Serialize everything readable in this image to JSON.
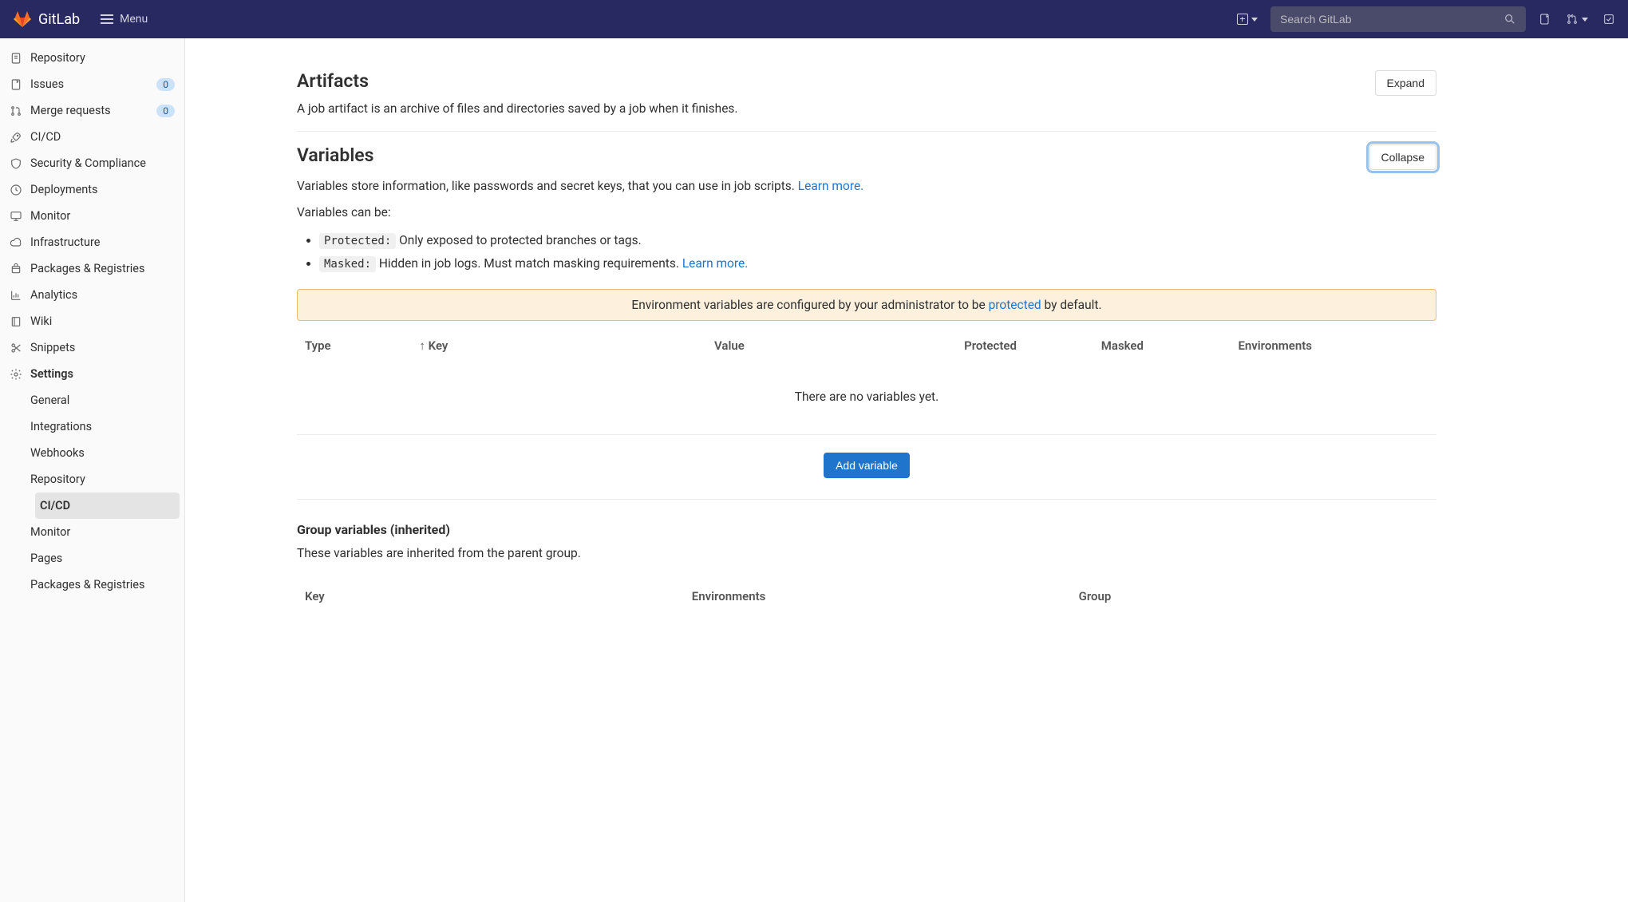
{
  "topnav": {
    "brand": "GitLab",
    "menu_label": "Menu",
    "search_placeholder": "Search GitLab"
  },
  "sidebar": {
    "items": [
      {
        "key": "repository",
        "label": "Repository"
      },
      {
        "key": "issues",
        "label": "Issues",
        "badge": "0"
      },
      {
        "key": "merge-requests",
        "label": "Merge requests",
        "badge": "0"
      },
      {
        "key": "cicd",
        "label": "CI/CD"
      },
      {
        "key": "security",
        "label": "Security & Compliance"
      },
      {
        "key": "deployments",
        "label": "Deployments"
      },
      {
        "key": "monitor",
        "label": "Monitor"
      },
      {
        "key": "infrastructure",
        "label": "Infrastructure"
      },
      {
        "key": "packages",
        "label": "Packages & Registries"
      },
      {
        "key": "analytics",
        "label": "Analytics"
      },
      {
        "key": "wiki",
        "label": "Wiki"
      },
      {
        "key": "snippets",
        "label": "Snippets"
      },
      {
        "key": "settings",
        "label": "Settings",
        "expanded": true
      }
    ],
    "settings_sub": [
      {
        "key": "general",
        "label": "General"
      },
      {
        "key": "integrations",
        "label": "Integrations"
      },
      {
        "key": "webhooks",
        "label": "Webhooks"
      },
      {
        "key": "repository",
        "label": "Repository"
      },
      {
        "key": "cicd",
        "label": "CI/CD",
        "active": true
      },
      {
        "key": "monitor",
        "label": "Monitor"
      },
      {
        "key": "pages",
        "label": "Pages"
      },
      {
        "key": "packages",
        "label": "Packages & Registries"
      }
    ]
  },
  "artifacts": {
    "title": "Artifacts",
    "desc": "A job artifact is an archive of files and directories saved by a job when it finishes.",
    "toggle": "Expand"
  },
  "variables": {
    "title": "Variables",
    "toggle": "Collapse",
    "intro_text": "Variables store information, like passwords and secret keys, that you can use in job scripts. ",
    "intro_link": "Learn more.",
    "can_be": "Variables can be:",
    "protected_code": "Protected:",
    "protected_text": " Only exposed to protected branches or tags.",
    "masked_code": "Masked:",
    "masked_text": " Hidden in job logs. Must match masking requirements. ",
    "masked_link": "Learn more.",
    "alert_prefix": "Environment variables are configured by your administrator to be ",
    "alert_link": "protected",
    "alert_suffix": " by default.",
    "columns": {
      "type": "Type",
      "key": "Key",
      "value": "Value",
      "protected": "Protected",
      "masked": "Masked",
      "environments": "Environments"
    },
    "empty": "There are no variables yet.",
    "add_button": "Add variable"
  },
  "group_variables": {
    "title": "Group variables (inherited)",
    "desc": "These variables are inherited from the parent group.",
    "columns": {
      "key": "Key",
      "environments": "Environments",
      "group": "Group"
    }
  }
}
